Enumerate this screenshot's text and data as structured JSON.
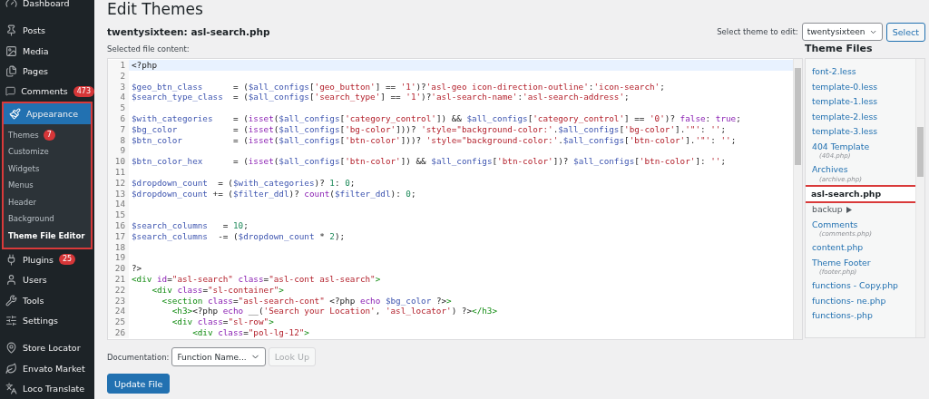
{
  "sidebar": {
    "groups": [
      [
        {
          "label": "Dashboard",
          "selected": false
        }
      ],
      [
        {
          "label": "Posts",
          "selected": false
        },
        {
          "label": "Media",
          "selected": false
        },
        {
          "label": "Pages",
          "selected": false
        },
        {
          "label": "Comments",
          "badge": "473",
          "selected": false
        },
        {
          "label": "Appearance",
          "selected": true,
          "highlighted": true,
          "children": [
            {
              "label": "Themes",
              "badge": "7",
              "selected": false
            },
            {
              "label": "Customize",
              "selected": false
            },
            {
              "label": "Widgets",
              "selected": false
            },
            {
              "label": "Menus",
              "selected": false
            },
            {
              "label": "Header",
              "selected": false
            },
            {
              "label": "Background",
              "selected": false
            },
            {
              "label": "Theme File Editor",
              "selected": true
            }
          ]
        },
        {
          "label": "Plugins",
          "badge": "25",
          "selected": false
        },
        {
          "label": "Users",
          "selected": false
        },
        {
          "label": "Tools",
          "selected": false
        },
        {
          "label": "Settings",
          "selected": false
        }
      ],
      [
        {
          "label": "Store Locator",
          "selected": false
        },
        {
          "label": "Envato Market",
          "selected": false
        },
        {
          "label": "Loco Translate",
          "selected": false
        }
      ]
    ]
  },
  "page": {
    "title": "Edit Themes",
    "file_heading": "twentysixteen: asl-search.php",
    "theme_select": {
      "label": "Select theme to edit:",
      "value": "twentysixteen",
      "button": "Select"
    },
    "content_label": "Selected file content:"
  },
  "editor": {
    "lines": [
      {
        "number": "1",
        "selected": true,
        "tokens": [
          {
            "kind": "plain",
            "text": "<?php"
          }
        ]
      },
      {
        "number": "2",
        "selected": false
      },
      {
        "number": "3",
        "selected": false,
        "tokens": [
          {
            "kind": "var",
            "text": "$geo_btn_class"
          },
          {
            "kind": "plain",
            "text": "      = ("
          },
          {
            "kind": "var",
            "text": "$all_configs"
          },
          {
            "kind": "plain",
            "text": "["
          },
          {
            "kind": "str",
            "text": "'geo_button'"
          },
          {
            "kind": "plain",
            "text": "] == "
          },
          {
            "kind": "str",
            "text": "'1'"
          },
          {
            "kind": "plain",
            "text": ")?"
          },
          {
            "kind": "str",
            "text": "'asl-geo icon-direction-outline'"
          },
          {
            "kind": "plain",
            "text": ":"
          },
          {
            "kind": "str",
            "text": "'icon-search'"
          },
          {
            "kind": "plain",
            "text": ";"
          }
        ]
      },
      {
        "number": "4",
        "selected": false,
        "tokens": [
          {
            "kind": "var",
            "text": "$search_type_class"
          },
          {
            "kind": "plain",
            "text": "  = ("
          },
          {
            "kind": "var",
            "text": "$all_configs"
          },
          {
            "kind": "plain",
            "text": "["
          },
          {
            "kind": "str",
            "text": "'search_type'"
          },
          {
            "kind": "plain",
            "text": "] == "
          },
          {
            "kind": "str",
            "text": "'1'"
          },
          {
            "kind": "plain",
            "text": ")?"
          },
          {
            "kind": "str",
            "text": "'asl-search-name'"
          },
          {
            "kind": "plain",
            "text": ":"
          },
          {
            "kind": "str",
            "text": "'asl-search-address'"
          },
          {
            "kind": "plain",
            "text": ";"
          }
        ]
      },
      {
        "number": "5",
        "selected": false
      },
      {
        "number": "6",
        "selected": false,
        "tokens": [
          {
            "kind": "var",
            "text": "$with_categories"
          },
          {
            "kind": "plain",
            "text": "    = ("
          },
          {
            "kind": "kw",
            "text": "isset"
          },
          {
            "kind": "plain",
            "text": "("
          },
          {
            "kind": "var",
            "text": "$all_configs"
          },
          {
            "kind": "plain",
            "text": "["
          },
          {
            "kind": "str",
            "text": "'category_control'"
          },
          {
            "kind": "plain",
            "text": "]) && "
          },
          {
            "kind": "var",
            "text": "$all_configs"
          },
          {
            "kind": "plain",
            "text": "["
          },
          {
            "kind": "str",
            "text": "'category_control'"
          },
          {
            "kind": "plain",
            "text": "] == "
          },
          {
            "kind": "str",
            "text": "'0'"
          },
          {
            "kind": "plain",
            "text": ")? "
          },
          {
            "kind": "kw",
            "text": "false"
          },
          {
            "kind": "plain",
            "text": ": "
          },
          {
            "kind": "kw",
            "text": "true"
          },
          {
            "kind": "plain",
            "text": ";"
          }
        ]
      },
      {
        "number": "7",
        "selected": false,
        "tokens": [
          {
            "kind": "var",
            "text": "$bg_color"
          },
          {
            "kind": "plain",
            "text": "           = ("
          },
          {
            "kind": "kw",
            "text": "isset"
          },
          {
            "kind": "plain",
            "text": "("
          },
          {
            "kind": "var",
            "text": "$all_configs"
          },
          {
            "kind": "plain",
            "text": "["
          },
          {
            "kind": "str",
            "text": "'bg-color'"
          },
          {
            "kind": "plain",
            "text": "]))? "
          },
          {
            "kind": "str",
            "text": "'style=\"background-color:'"
          },
          {
            "kind": "plain",
            "text": "."
          },
          {
            "kind": "var",
            "text": "$all_configs"
          },
          {
            "kind": "plain",
            "text": "["
          },
          {
            "kind": "str",
            "text": "'bg-color'"
          },
          {
            "kind": "plain",
            "text": "]."
          },
          {
            "kind": "str",
            "text": "'\"'"
          },
          {
            "kind": "plain",
            "text": ": "
          },
          {
            "kind": "str",
            "text": "''"
          },
          {
            "kind": "plain",
            "text": ";"
          }
        ]
      },
      {
        "number": "8",
        "selected": false,
        "tokens": [
          {
            "kind": "var",
            "text": "$btn_color"
          },
          {
            "kind": "plain",
            "text": "          = ("
          },
          {
            "kind": "kw",
            "text": "isset"
          },
          {
            "kind": "plain",
            "text": "("
          },
          {
            "kind": "var",
            "text": "$all_configs"
          },
          {
            "kind": "plain",
            "text": "["
          },
          {
            "kind": "str",
            "text": "'btn-color'"
          },
          {
            "kind": "plain",
            "text": "]))? "
          },
          {
            "kind": "str",
            "text": "'style=\"background-color:'"
          },
          {
            "kind": "plain",
            "text": "."
          },
          {
            "kind": "var",
            "text": "$all_configs"
          },
          {
            "kind": "plain",
            "text": "["
          },
          {
            "kind": "str",
            "text": "'btn-color'"
          },
          {
            "kind": "plain",
            "text": "]."
          },
          {
            "kind": "str",
            "text": "'\"'"
          },
          {
            "kind": "plain",
            "text": ": "
          },
          {
            "kind": "str",
            "text": "''"
          },
          {
            "kind": "plain",
            "text": ";"
          }
        ]
      },
      {
        "number": "9",
        "selected": false
      },
      {
        "number": "10",
        "selected": false,
        "tokens": [
          {
            "kind": "var",
            "text": "$btn_color_hex"
          },
          {
            "kind": "plain",
            "text": "      = ("
          },
          {
            "kind": "kw",
            "text": "isset"
          },
          {
            "kind": "plain",
            "text": "("
          },
          {
            "kind": "var",
            "text": "$all_configs"
          },
          {
            "kind": "plain",
            "text": "["
          },
          {
            "kind": "str",
            "text": "'btn-color'"
          },
          {
            "kind": "plain",
            "text": "]) && "
          },
          {
            "kind": "var",
            "text": "$all_configs"
          },
          {
            "kind": "plain",
            "text": "["
          },
          {
            "kind": "str",
            "text": "'btn-color'"
          },
          {
            "kind": "plain",
            "text": "])? "
          },
          {
            "kind": "var",
            "text": "$all_configs"
          },
          {
            "kind": "plain",
            "text": "["
          },
          {
            "kind": "str",
            "text": "'btn-color'"
          },
          {
            "kind": "plain",
            "text": "]: "
          },
          {
            "kind": "str",
            "text": "''"
          },
          {
            "kind": "plain",
            "text": ";"
          }
        ]
      },
      {
        "number": "11",
        "selected": false
      },
      {
        "number": "12",
        "selected": false,
        "tokens": [
          {
            "kind": "var",
            "text": "$dropdown_count"
          },
          {
            "kind": "plain",
            "text": "  = ("
          },
          {
            "kind": "var",
            "text": "$with_categories"
          },
          {
            "kind": "plain",
            "text": ")? "
          },
          {
            "kind": "num",
            "text": "1"
          },
          {
            "kind": "plain",
            "text": ": "
          },
          {
            "kind": "num",
            "text": "0"
          },
          {
            "kind": "plain",
            "text": ";"
          }
        ]
      },
      {
        "number": "13",
        "selected": false,
        "tokens": [
          {
            "kind": "var",
            "text": "$dropdown_count"
          },
          {
            "kind": "plain",
            "text": " += ("
          },
          {
            "kind": "var",
            "text": "$filter_ddl"
          },
          {
            "kind": "plain",
            "text": ")? "
          },
          {
            "kind": "kw",
            "text": "count"
          },
          {
            "kind": "plain",
            "text": "("
          },
          {
            "kind": "var",
            "text": "$filter_ddl"
          },
          {
            "kind": "plain",
            "text": "): "
          },
          {
            "kind": "num",
            "text": "0"
          },
          {
            "kind": "plain",
            "text": ";"
          }
        ]
      },
      {
        "number": "14",
        "selected": false
      },
      {
        "number": "15",
        "selected": false
      },
      {
        "number": "16",
        "selected": false,
        "tokens": [
          {
            "kind": "var",
            "text": "$search_columns"
          },
          {
            "kind": "plain",
            "text": "   = "
          },
          {
            "kind": "num",
            "text": "10"
          },
          {
            "kind": "plain",
            "text": ";"
          }
        ]
      },
      {
        "number": "17",
        "selected": false,
        "tokens": [
          {
            "kind": "var",
            "text": "$search_columns"
          },
          {
            "kind": "plain",
            "text": "  -= ("
          },
          {
            "kind": "var",
            "text": "$dropdown_count"
          },
          {
            "kind": "plain",
            "text": " * "
          },
          {
            "kind": "num",
            "text": "2"
          },
          {
            "kind": "plain",
            "text": ");"
          }
        ]
      },
      {
        "number": "18",
        "selected": false
      },
      {
        "number": "19",
        "selected": false
      },
      {
        "number": "20",
        "selected": false,
        "tokens": [
          {
            "kind": "plain",
            "text": "?>"
          }
        ]
      },
      {
        "number": "21",
        "selected": false,
        "tokens": [
          {
            "kind": "tag",
            "text": "<div"
          },
          {
            "kind": "attr",
            "text": " id"
          },
          {
            "kind": "plain",
            "text": "="
          },
          {
            "kind": "str",
            "text": "\"asl-search\""
          },
          {
            "kind": "attr",
            "text": " class"
          },
          {
            "kind": "plain",
            "text": "="
          },
          {
            "kind": "str",
            "text": "\"asl-cont asl-search\""
          },
          {
            "kind": "tag",
            "text": ">"
          }
        ]
      },
      {
        "number": "22",
        "selected": false,
        "tokens": [
          {
            "kind": "tag",
            "text": "    <div"
          },
          {
            "kind": "attr",
            "text": " class"
          },
          {
            "kind": "plain",
            "text": "="
          },
          {
            "kind": "str",
            "text": "\"sl-container\""
          },
          {
            "kind": "tag",
            "text": ">"
          }
        ]
      },
      {
        "number": "23",
        "selected": false,
        "tokens": [
          {
            "kind": "tag",
            "text": "      <section"
          },
          {
            "kind": "attr",
            "text": " class"
          },
          {
            "kind": "plain",
            "text": "="
          },
          {
            "kind": "str",
            "text": "\"asl-search-cont\""
          },
          {
            "kind": "plain",
            "text": " <?php "
          },
          {
            "kind": "kw",
            "text": "echo"
          },
          {
            "kind": "var",
            "text": " $bg_color"
          },
          {
            "kind": "plain",
            "text": " ?>"
          },
          {
            "kind": "tag",
            "text": ">"
          }
        ]
      },
      {
        "number": "24",
        "selected": false,
        "tokens": [
          {
            "kind": "tag",
            "text": "        <h3>"
          },
          {
            "kind": "plain",
            "text": "<?php "
          },
          {
            "kind": "kw",
            "text": "echo"
          },
          {
            "kind": "plain",
            "text": " __("
          },
          {
            "kind": "str",
            "text": "'Search your Location'"
          },
          {
            "kind": "plain",
            "text": ", "
          },
          {
            "kind": "str",
            "text": "'asl_locator'"
          },
          {
            "kind": "plain",
            "text": ") ?>"
          },
          {
            "kind": "tag",
            "text": "</h3>"
          }
        ]
      },
      {
        "number": "25",
        "selected": false,
        "tokens": [
          {
            "kind": "tag",
            "text": "        <div"
          },
          {
            "kind": "attr",
            "text": " class"
          },
          {
            "kind": "plain",
            "text": "="
          },
          {
            "kind": "str",
            "text": "\"sl-row\""
          },
          {
            "kind": "tag",
            "text": ">"
          }
        ]
      },
      {
        "number": "26",
        "selected": false,
        "tokens": [
          {
            "kind": "tag",
            "text": "            <div"
          },
          {
            "kind": "attr",
            "text": " class"
          },
          {
            "kind": "plain",
            "text": "="
          },
          {
            "kind": "str",
            "text": "\"pol-lg-12\""
          },
          {
            "kind": "tag",
            "text": ">"
          }
        ]
      }
    ]
  },
  "theme_files": {
    "title": "Theme Files",
    "items": [
      {
        "kind": "file",
        "name": "font-2.less",
        "selected": false
      },
      {
        "kind": "file",
        "name": "template-0.less",
        "selected": false
      },
      {
        "kind": "file",
        "name": "template-1.less",
        "selected": false
      },
      {
        "kind": "file",
        "name": "template-2.less",
        "selected": false
      },
      {
        "kind": "file",
        "name": "template-3.less",
        "selected": false
      },
      {
        "kind": "file",
        "name": "404 Template",
        "subtitle": "(404.php)",
        "selected": false
      },
      {
        "kind": "file",
        "name": "Archives",
        "subtitle": "(archive.php)",
        "selected": false
      },
      {
        "kind": "file",
        "name": "asl-search.php",
        "selected": true,
        "highlighted": true
      },
      {
        "kind": "folder",
        "name": "backup",
        "expanded": false
      },
      {
        "kind": "file",
        "name": "Comments",
        "subtitle": "(comments.php)",
        "selected": false
      },
      {
        "kind": "file",
        "name": "content.php",
        "selected": false
      },
      {
        "kind": "file",
        "name": "Theme Footer",
        "subtitle": "(footer.php)",
        "selected": false
      },
      {
        "kind": "file",
        "name": "functions - Copy.php",
        "selected": false
      },
      {
        "kind": "file",
        "name": "functions- ne.php",
        "selected": false
      },
      {
        "kind": "file",
        "name": "functions-.php",
        "selected": false
      }
    ]
  },
  "documentation": {
    "label": "Documentation:",
    "select_value": "Function Name...",
    "lookup_button": "Look Up",
    "lookup_disabled": true
  },
  "update_button": "Update File"
}
